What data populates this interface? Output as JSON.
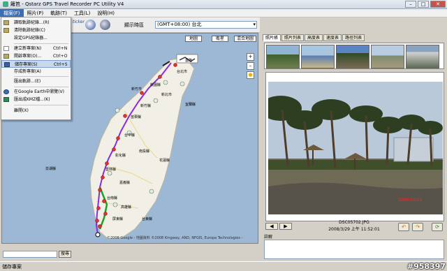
{
  "window": {
    "title": "籬笆 - Qstarz GPS Travel Recorder PC Utility V4"
  },
  "menu": [
    "檔案(F)",
    "照片(P)",
    "軌跡(T)",
    "工具(L)",
    "說明(H)"
  ],
  "file_menu": [
    {
      "label": "讀取軌跡紀錄...(R)",
      "shortcut": ""
    },
    {
      "label": "清除軌跡紀錄(C)",
      "shortcut": ""
    },
    {
      "label": "設定GPS紀錄器...",
      "shortcut": ""
    },
    {
      "label": "建立新專案(N)",
      "shortcut": "Ctrl+N"
    },
    {
      "label": "開啟專案(O)...",
      "shortcut": "Ctrl+O"
    },
    {
      "label": "儲存專案(S)",
      "shortcut": "Ctrl+S"
    },
    {
      "label": "存成新專案(A)",
      "shortcut": ""
    },
    {
      "label": "匯出軌跡...(E)",
      "shortcut": ""
    },
    {
      "label": "在Google Earth中瀏覽(V)",
      "shortcut": ""
    },
    {
      "label": "匯出成KMZ檔...(K)",
      "shortcut": ""
    },
    {
      "label": "離開(X)",
      "shortcut": ""
    }
  ],
  "toolbar": {
    "timezone_label": "顯示時區",
    "timezone_value": "(GMT+08:00) 台北",
    "partial_text": "ticker"
  },
  "map": {
    "types": [
      "地圖",
      "衛星",
      "混合地圖"
    ],
    "places": [
      "台北市",
      "基隆",
      "新竹縣",
      "苗栗縣",
      "台中縣",
      "南投縣",
      "彰化縣",
      "雲林縣",
      "嘉義縣",
      "台南縣",
      "高雄縣",
      "屏東縣",
      "花蓮縣",
      "台東縣",
      "宜蘭縣",
      "新北市",
      "新竹市",
      "桃園縣",
      "澎湖縣"
    ],
    "copyright": "©2008 Google - 地圖資料 ©2008 Kingway, AND, NFGIS, Europa Technologies -",
    "search_button": "搜尋"
  },
  "right_panel": {
    "tabs": [
      "照片帳",
      "照片列表",
      "高度表",
      "速度表",
      "路徑列表"
    ],
    "filename": "DSC05702.JPG",
    "datetime": "2008/3/29 上午 11:52:01",
    "note_label": "註解",
    "photo_date": "2008/03/29"
  },
  "status": {
    "text": "儲存專案"
  },
  "watermark": "#958397",
  "colors": {
    "route": "#8a2be2",
    "highlight": "#c7d8ee",
    "menu_active": "#3a6fb5",
    "marker": "#e03030"
  }
}
